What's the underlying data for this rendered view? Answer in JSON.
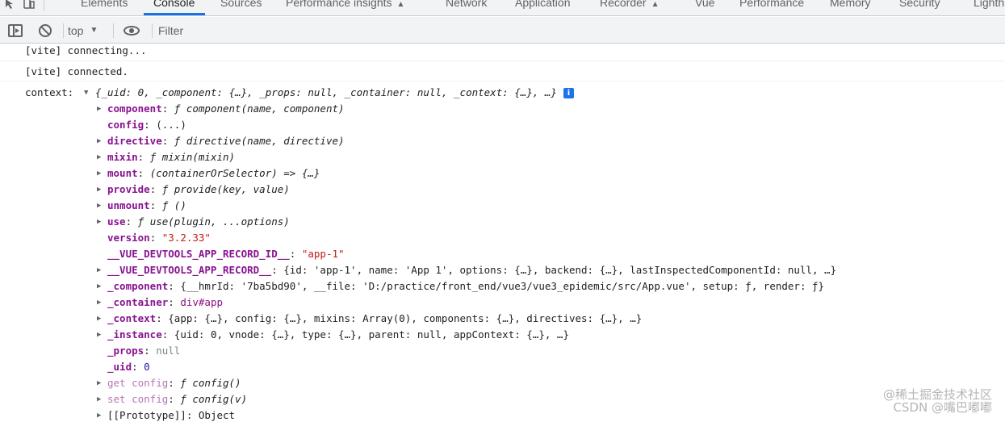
{
  "tabs": [
    {
      "label": "Elements",
      "active": false,
      "warning": false
    },
    {
      "label": "Console",
      "active": true,
      "warning": false
    },
    {
      "label": "Sources",
      "active": false,
      "warning": false
    },
    {
      "label": "Performance insights",
      "active": false,
      "warning": true
    },
    {
      "label": "Network",
      "active": false,
      "warning": false
    },
    {
      "label": "Application",
      "active": false,
      "warning": false
    },
    {
      "label": "Recorder",
      "active": false,
      "warning": true
    },
    {
      "label": "Vue",
      "active": false,
      "warning": false
    },
    {
      "label": "Performance",
      "active": false,
      "warning": false
    },
    {
      "label": "Memory",
      "active": false,
      "warning": false
    },
    {
      "label": "Security",
      "active": false,
      "warning": false
    },
    {
      "label": "Lighth",
      "active": false,
      "warning": false
    }
  ],
  "toolbar": {
    "context": "top",
    "filter_placeholder": "Filter"
  },
  "console": {
    "messages": [
      "[vite] connecting...",
      "[vite] connected."
    ],
    "context_label": "context:",
    "context_preview": "{_uid: 0, _component: {…}, _props: null, _container: null, _context: {…}, …}",
    "info": "i",
    "props": [
      {
        "key": "component",
        "sep": ": ",
        "value": "ƒ component(name, component)"
      },
      {
        "key": "config",
        "sep": ": ",
        "value": "(...)"
      },
      {
        "key": "directive",
        "sep": ": ",
        "value": "ƒ directive(name, directive)"
      },
      {
        "key": "mixin",
        "sep": ": ",
        "value": "ƒ mixin(mixin)"
      },
      {
        "key": "mount",
        "sep": ": ",
        "value": "(containerOrSelector) => {…}"
      },
      {
        "key": "provide",
        "sep": ": ",
        "value": "ƒ provide(key, value)"
      },
      {
        "key": "unmount",
        "sep": ": ",
        "value": "ƒ ()"
      },
      {
        "key": "use",
        "sep": ": ",
        "value": "ƒ use(plugin, ...options)"
      },
      {
        "key": "version",
        "sep": ": ",
        "value": "\"3.2.33\""
      },
      {
        "key": "__VUE_DEVTOOLS_APP_RECORD_ID__",
        "sep": ": ",
        "value": "\"app-1\""
      },
      {
        "key": "__VUE_DEVTOOLS_APP_RECORD__",
        "sep": ": ",
        "value": "{id: 'app-1', name: 'App 1', options: {…}, backend: {…}, lastInspectedComponentId: null, …}"
      },
      {
        "key": "_component",
        "sep": ": ",
        "value": "{__hmrId: '7ba5bd90', __file: 'D:/practice/front_end/vue3/vue3_epidemic/src/App.vue', setup: ƒ, render: ƒ}"
      },
      {
        "key": "_container",
        "sep": ": ",
        "value": "div#app"
      },
      {
        "key": "_context",
        "sep": ": ",
        "value": "{app: {…}, config: {…}, mixins: Array(0), components: {…}, directives: {…}, …}"
      },
      {
        "key": "_instance",
        "sep": ": ",
        "value": "{uid: 0, vnode: {…}, type: {…}, parent: null, appContext: {…}, …}"
      },
      {
        "key": "_props",
        "sep": ": ",
        "value": "null"
      },
      {
        "key": "_uid",
        "sep": ": ",
        "value": "0"
      },
      {
        "key": "get config",
        "sep": ": ",
        "value": "ƒ config()"
      },
      {
        "key": "set config",
        "sep": ": ",
        "value": "ƒ config(v)"
      },
      {
        "key": "[[Prototype]]",
        "sep": ": ",
        "value": "Object"
      }
    ]
  },
  "watermark": {
    "line1": "@稀土掘金技术社区",
    "line2": "CSDN @嘴巴嘟嘟"
  }
}
